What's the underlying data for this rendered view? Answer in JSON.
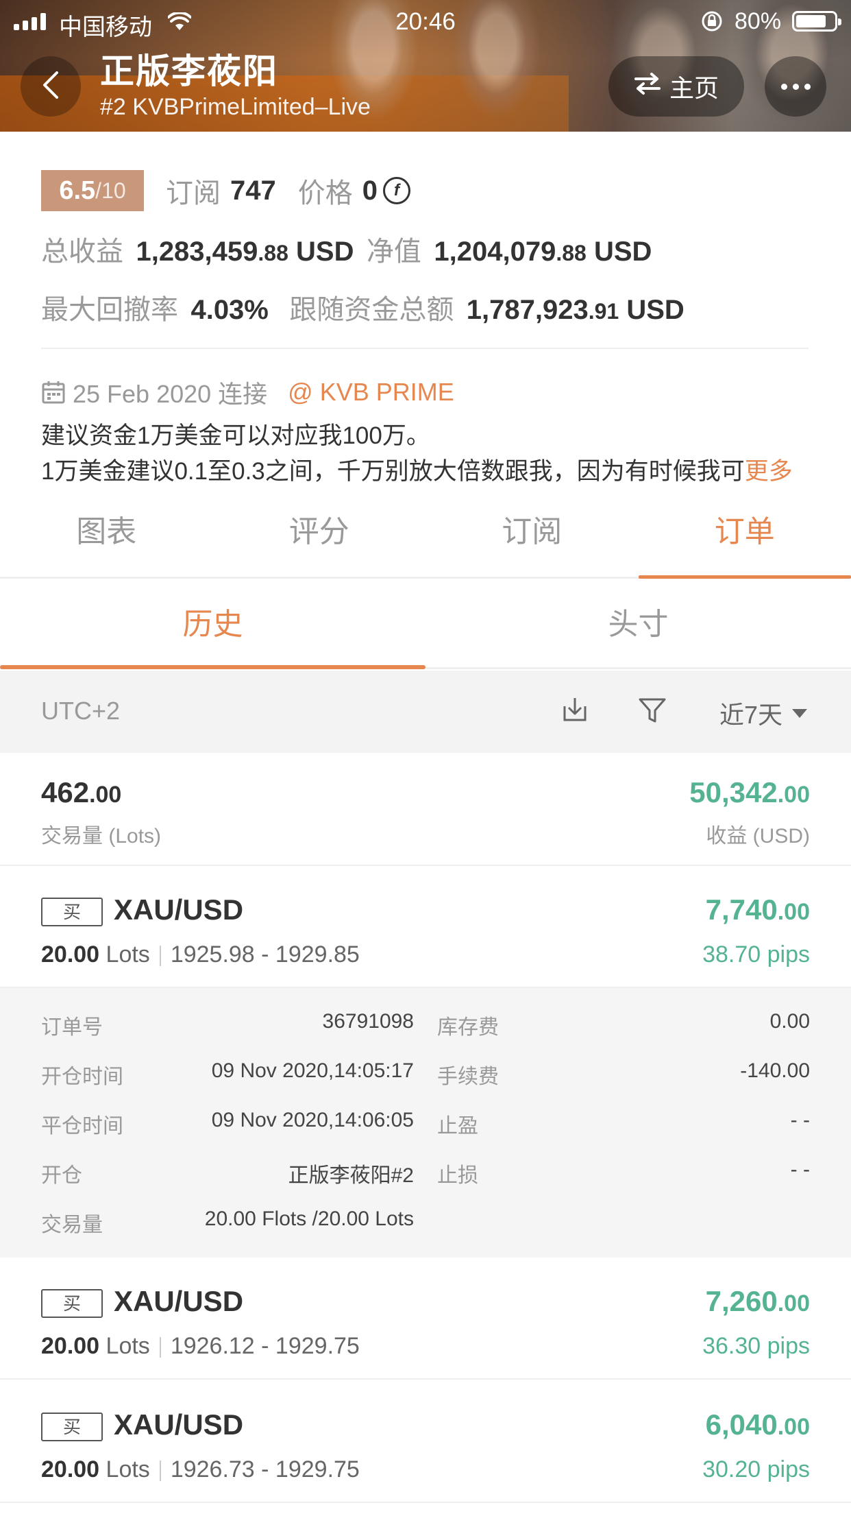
{
  "status_bar": {
    "carrier": "中国移动",
    "time": "20:46",
    "battery": "80%",
    "battery_level": 0.8
  },
  "header": {
    "title": "正版李莜阳",
    "subtitle": "#2 KVBPrimeLimited–Live",
    "home_label": "主页"
  },
  "stats": {
    "score": "6.5",
    "score_den": "/10",
    "subscribe_label": "订阅",
    "subscribe_count": "747",
    "price_label": "价格",
    "price_value": "0",
    "coin_symbol": "f",
    "total_profit_label": "总收益",
    "total_profit_int": "1,283,459",
    "total_profit_dec": ".88",
    "total_profit_cur": "USD",
    "net_label": "净值",
    "net_int": "1,204,079",
    "net_dec": ".88",
    "net_cur": "USD",
    "drawdown_label": "最大回撤率",
    "drawdown_value": "4.03%",
    "follow_label": "跟随资金总额",
    "follow_int": "1,787,923",
    "follow_dec": ".91",
    "follow_cur": "USD",
    "connect_date": "25 Feb 2020 连接",
    "broker": "@ KVB PRIME",
    "desc_line1": "建议资金1万美金可以对应我100万。",
    "desc_line2": "1万美金建议0.1至0.3之间，千万别放大倍数跟我，因为有时候我可",
    "more": "更多"
  },
  "tabs": [
    "图表",
    "评分",
    "订阅",
    "订单"
  ],
  "subtabs": [
    "历史",
    "头寸"
  ],
  "filter": {
    "timezone": "UTC+2",
    "period": "近7天"
  },
  "summary": {
    "volume_int": "462",
    "volume_dec": ".00",
    "volume_label": "交易量 (Lots)",
    "profit_int": "50,342",
    "profit_dec": ".00",
    "profit_label": "收益 (USD)"
  },
  "orders": [
    {
      "side": "买",
      "symbol": "XAU/USD",
      "lots": "20.00",
      "lots_unit": "Lots",
      "prices": "1925.98 - 1929.85",
      "profit_int": "7,740",
      "profit_dec": ".00",
      "pips": "38.70 pips"
    },
    {
      "side": "买",
      "symbol": "XAU/USD",
      "lots": "20.00",
      "lots_unit": "Lots",
      "prices": "1926.12 - 1929.75",
      "profit_int": "7,260",
      "profit_dec": ".00",
      "pips": "36.30 pips"
    },
    {
      "side": "买",
      "symbol": "XAU/USD",
      "lots": "20.00",
      "lots_unit": "Lots",
      "prices": "1926.73 - 1929.75",
      "profit_int": "6,040",
      "profit_dec": ".00",
      "pips": "30.20 pips"
    }
  ],
  "detail": {
    "order_no_label": "订单号",
    "order_no": "36791098",
    "swap_label": "库存费",
    "swap": "0.00",
    "open_time_label": "开仓时间",
    "open_time": "09 Nov 2020,14:05:17",
    "fee_label": "手续费",
    "fee": "-140.00",
    "close_time_label": "平仓时间",
    "close_time": "09 Nov 2020,14:06:05",
    "tp_label": "止盈",
    "tp": "- -",
    "open_label": "开仓",
    "open_by": "正版李莜阳#2",
    "sl_label": "止损",
    "sl": "- -",
    "volume_label": "交易量",
    "volume": "20.00 Flots /20.00 Lots"
  },
  "colors": {
    "accent": "#e5874f",
    "profit_green": "#55b391",
    "score_bg": "#c9977a"
  }
}
